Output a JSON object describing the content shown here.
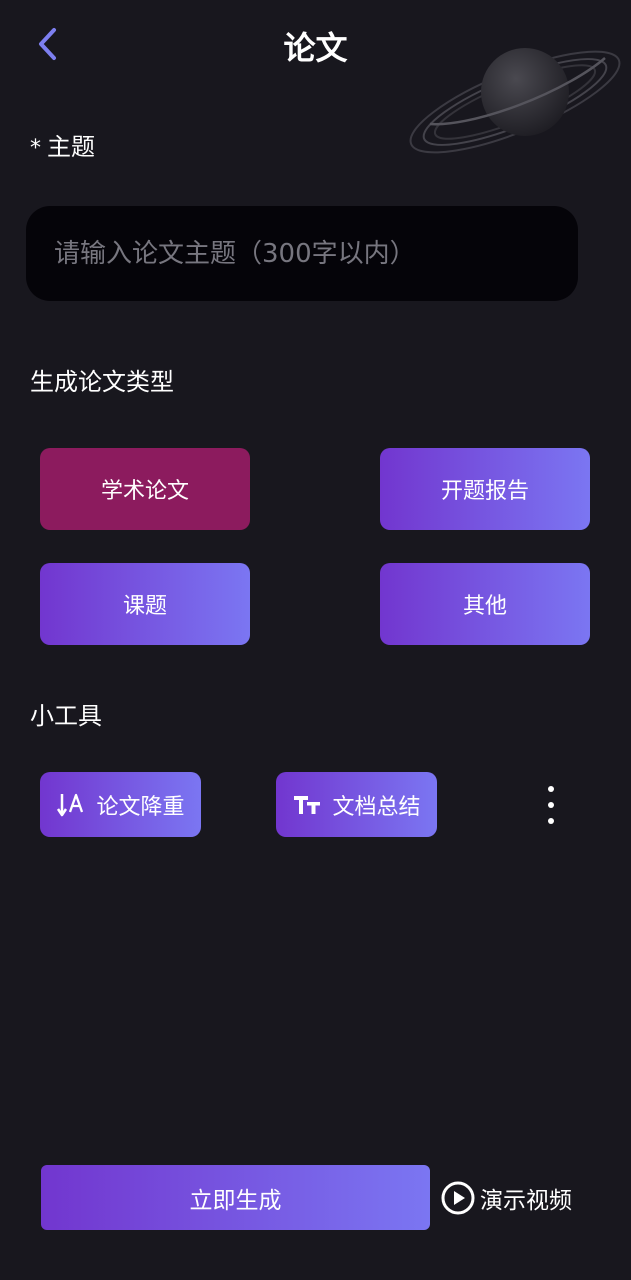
{
  "header": {
    "title": "论文",
    "back_icon": "chevron-left-icon"
  },
  "topic": {
    "required_mark": "*",
    "label": "主题",
    "placeholder": "请输入论文主题（300字以内）",
    "value": ""
  },
  "paper_types": {
    "label": "生成论文类型",
    "selected": "学术论文",
    "items": [
      {
        "label": "学术论文"
      },
      {
        "label": "开题报告"
      },
      {
        "label": "课题"
      },
      {
        "label": "其他"
      }
    ]
  },
  "tools": {
    "label": "小工具",
    "items": [
      {
        "label": "论文降重",
        "icon": "sort-text-icon"
      },
      {
        "label": "文档总结",
        "icon": "text-size-icon"
      }
    ],
    "more_icon": "more-vertical-icon"
  },
  "footer": {
    "generate_label": "立即生成",
    "demo_label": "演示视频",
    "demo_icon": "play-circle-icon"
  },
  "colors": {
    "background": "#18171e",
    "input_bg": "#050409",
    "selected_type": "#8c1b5e",
    "gradient_start": "#7236cf",
    "gradient_end": "#7b76f2",
    "back_arrow": "#7d7ff0"
  }
}
